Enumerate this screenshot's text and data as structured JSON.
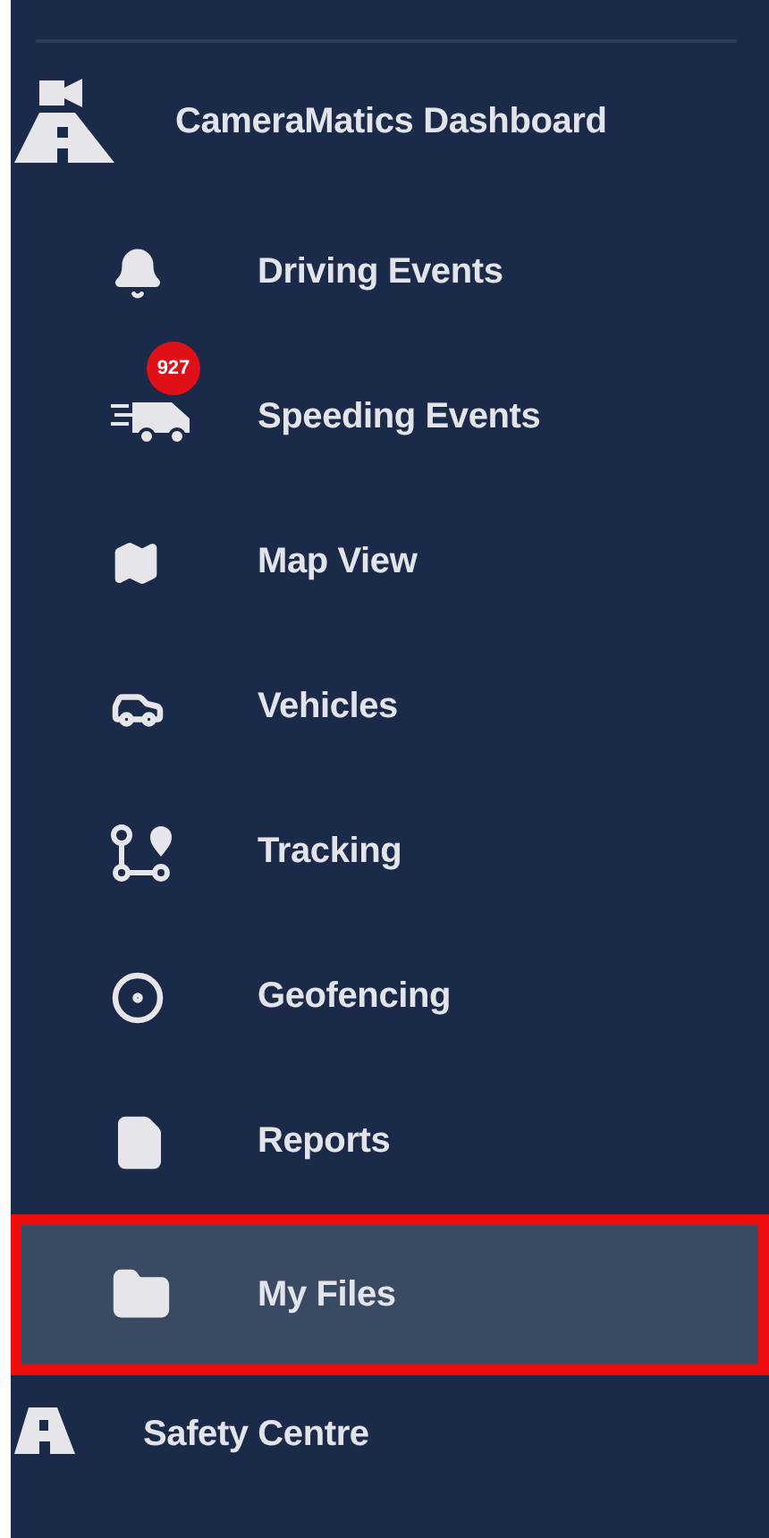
{
  "header": {
    "title": "CameraMatics Dashboard"
  },
  "items": [
    {
      "kind": "bell",
      "label": "Driving Events",
      "selected": false
    },
    {
      "kind": "speeding",
      "label": "Speeding Events",
      "badge": "927",
      "selected": false
    },
    {
      "kind": "map",
      "label": "Map View",
      "selected": false
    },
    {
      "kind": "car",
      "label": "Vehicles",
      "selected": false
    },
    {
      "kind": "tracking",
      "label": "Tracking",
      "selected": false
    },
    {
      "kind": "geofence",
      "label": "Geofencing",
      "selected": false
    },
    {
      "kind": "report",
      "label": "Reports",
      "selected": false
    },
    {
      "kind": "folder",
      "label": "My Files",
      "selected": true
    }
  ],
  "footer": {
    "label": "Safety Centre"
  }
}
